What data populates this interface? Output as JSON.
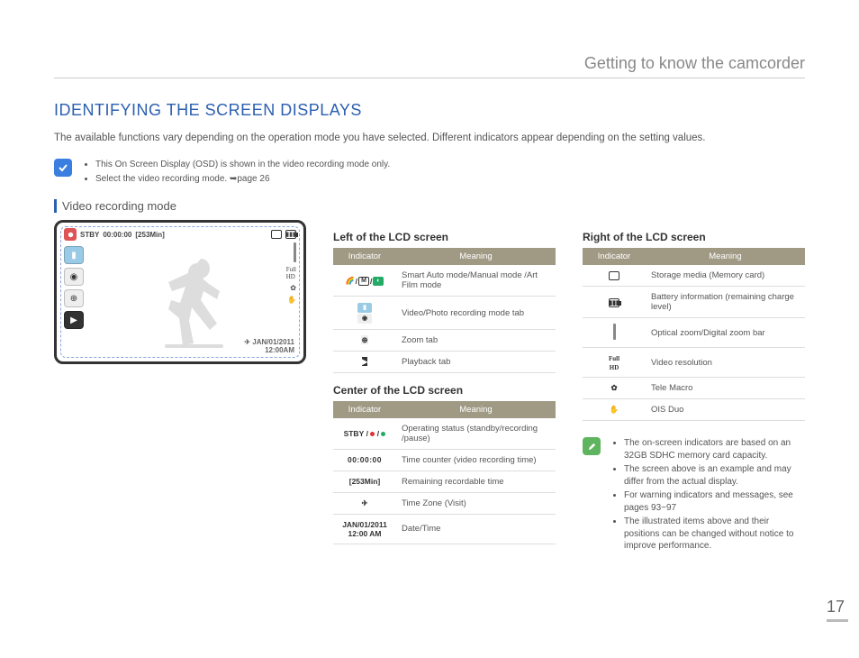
{
  "chapter_title": "Getting to know the camcorder",
  "section_title": "IDENTIFYING THE SCREEN DISPLAYS",
  "intro": "The available functions vary depending on the operation mode you have selected. Different indicators appear depending on the setting values.",
  "top_notes": [
    "This On Screen Display (OSD) is shown in the video recording mode only.",
    "Select the video recording mode. ➥page 26"
  ],
  "subheading": "Video recording mode",
  "osd": {
    "stby": "STBY",
    "timer": "00:00:00",
    "remaining": "[253Min]",
    "date": "JAN/01/2011",
    "time": "12:00AM"
  },
  "tables": {
    "left": {
      "title": "Left of the LCD screen",
      "headers": [
        "Indicator",
        "Meaning"
      ],
      "rows": [
        {
          "indicator": "smart-manual-art-modes",
          "display": "",
          "meaning": "Smart Auto mode/Manual mode /Art Film mode"
        },
        {
          "indicator": "video-photo-tab",
          "display": "",
          "meaning": "Video/Photo recording mode tab"
        },
        {
          "indicator": "zoom-tab",
          "display": "",
          "meaning": "Zoom tab"
        },
        {
          "indicator": "playback-tab",
          "display": "",
          "meaning": "Playback tab"
        }
      ]
    },
    "center": {
      "title": "Center of the LCD screen",
      "headers": [
        "Indicator",
        "Meaning"
      ],
      "rows": [
        {
          "indicator": "operating-status",
          "display": "STBY / ● / ❚❚",
          "meaning": "Operating status (standby/recording /pause)"
        },
        {
          "indicator": "time-counter",
          "display": "00:00:00",
          "meaning": "Time counter (video recording time)"
        },
        {
          "indicator": "remaining-time",
          "display": "[253Min]",
          "meaning": "Remaining recordable time"
        },
        {
          "indicator": "time-zone",
          "display": "",
          "meaning": "Time Zone (Visit)"
        },
        {
          "indicator": "date-time",
          "display": "JAN/01/2011\n12:00 AM",
          "meaning": "Date/Time"
        }
      ]
    },
    "right": {
      "title": "Right of the LCD screen",
      "headers": [
        "Indicator",
        "Meaning"
      ],
      "rows": [
        {
          "indicator": "storage-media",
          "display": "",
          "meaning": "Storage media (Memory card)"
        },
        {
          "indicator": "battery",
          "display": "",
          "meaning": "Battery information (remaining charge level)"
        },
        {
          "indicator": "zoom-bar",
          "display": "",
          "meaning": "Optical zoom/Digital zoom bar"
        },
        {
          "indicator": "video-resolution",
          "display": "",
          "meaning": "Video resolution"
        },
        {
          "indicator": "tele-macro",
          "display": "",
          "meaning": "Tele Macro"
        },
        {
          "indicator": "ois-duo",
          "display": "",
          "meaning": "OIS Duo"
        }
      ]
    }
  },
  "bottom_notes": [
    "The on-screen indicators are based on an 32GB SDHC memory card capacity.",
    "The screen above is an example and may differ from the actual display.",
    "For warning indicators and messages, see pages 93~97",
    "The illustrated items above and their positions can be changed without notice to improve performance."
  ],
  "page_number": "17"
}
